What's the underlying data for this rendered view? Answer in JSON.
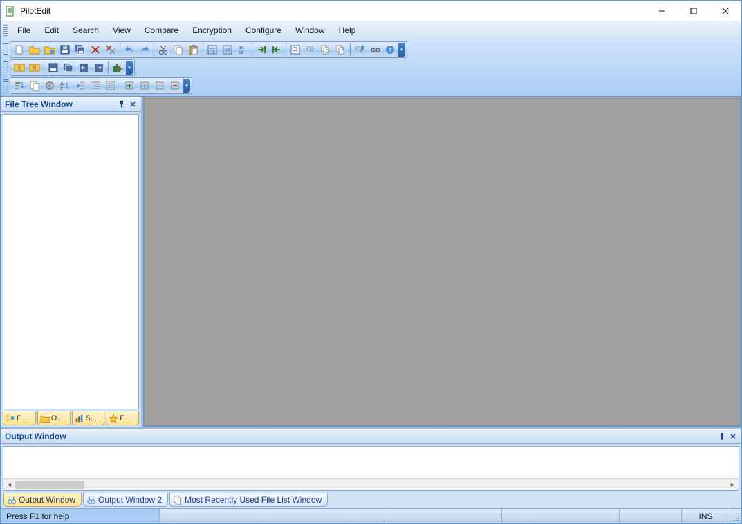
{
  "title": "PilotEdit",
  "menu": [
    "File",
    "Edit",
    "Search",
    "View",
    "Compare",
    "Encryption",
    "Configure",
    "Window",
    "Help"
  ],
  "toolbar1_icons": [
    "new-file-icon",
    "open-file-icon",
    "open-ftp-icon",
    "save-icon",
    "save-all-icon",
    "close-icon",
    "close-all-icon",
    "sep",
    "undo-icon",
    "redo-icon",
    "sep",
    "cut-icon",
    "copy-icon",
    "paste-icon",
    "sep",
    "word-wrap-icon",
    "hex-icon",
    "column-mode-icon",
    "sep",
    "next-icon",
    "prev-icon",
    "sep",
    "find-icon",
    "find-replace-icon",
    "find-files-icon",
    "replace-files-icon",
    "sep",
    "bookmark-icon",
    "goto-icon",
    "help-icon"
  ],
  "toolbar2_icons": [
    "compare-icon",
    "compare-merge-icon",
    "sep",
    "compare-dir-icon",
    "sync-icon",
    "copy-left-icon",
    "copy-right-icon",
    "sep",
    "run-icon"
  ],
  "toolbar3_icons": [
    "sort-icon",
    "filter-icon",
    "options-icon",
    "sort-az-icon",
    "indent-left-icon",
    "indent-right-icon",
    "format-icon",
    "sep",
    "expand-icon",
    "add-icon",
    "remove-icon",
    "collapse-icon"
  ],
  "sidebar": {
    "title": "File Tree Window",
    "tabs": [
      {
        "label": "F...",
        "icon": "tree-icon"
      },
      {
        "label": "O...",
        "icon": "folder-icon"
      },
      {
        "label": "S...",
        "icon": "chart-icon"
      },
      {
        "label": "F...",
        "icon": "star-icon"
      }
    ]
  },
  "output": {
    "title": "Output Window",
    "tabs": [
      {
        "label": "Output Window",
        "icon": "output-icon",
        "active": true
      },
      {
        "label": "Output Window 2",
        "icon": "output-icon",
        "active": false
      },
      {
        "label": "Most Recently Used File List Window",
        "icon": "mru-icon",
        "active": false
      }
    ]
  },
  "status": {
    "help": "Press F1 for help",
    "ins": "INS"
  }
}
